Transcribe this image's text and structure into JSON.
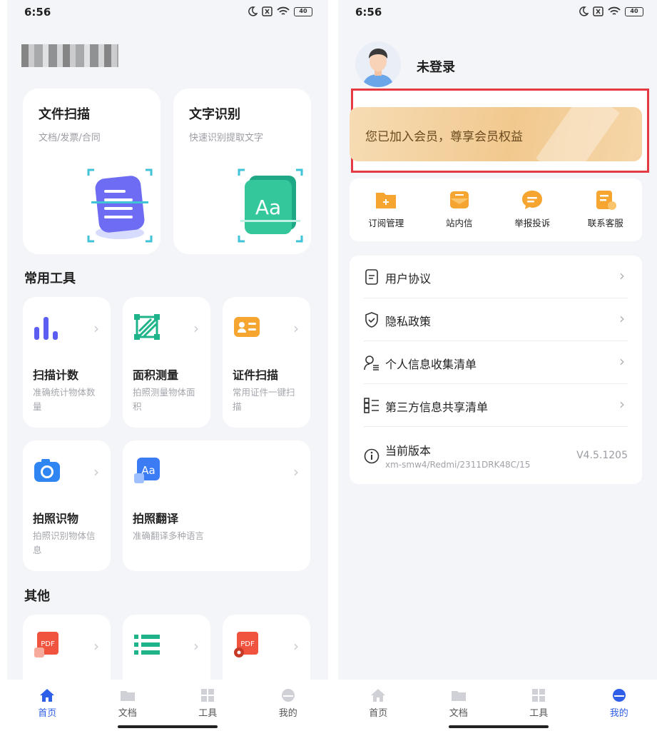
{
  "status": {
    "time": "6:56",
    "battery": "40"
  },
  "left": {
    "cards": [
      {
        "title": "文件扫描",
        "subtitle": "文档/发票/合同"
      },
      {
        "title": "文字识别",
        "subtitle": "快速识别提取文字",
        "icon_text": "Aa"
      }
    ],
    "section_common": "常用工具",
    "tools": [
      {
        "title": "扫描计数",
        "desc": "准确统计物体数量",
        "icon": "bar-chart-icon"
      },
      {
        "title": "面积测量",
        "desc": "拍照测量物体面积",
        "icon": "area-measure-icon"
      },
      {
        "title": "证件扫描",
        "desc": "常用证件一键扫描",
        "icon": "id-card-icon"
      },
      {
        "title": "拍照识物",
        "desc": "拍照识别物体信息",
        "icon": "camera-icon"
      },
      {
        "title": "拍照翻译",
        "desc": "准确翻译多种语言",
        "icon": "translate-icon",
        "icon_text": "Aa"
      }
    ],
    "section_other": "其他",
    "others": [
      {
        "icon": "pdf-image-icon",
        "icon_text": "PDF"
      },
      {
        "icon": "list-icon"
      },
      {
        "icon": "pdf-settings-icon",
        "icon_text": "PDF"
      }
    ]
  },
  "nav": [
    {
      "label": "首页",
      "icon": "home-icon"
    },
    {
      "label": "文档",
      "icon": "folder-icon"
    },
    {
      "label": "工具",
      "icon": "tools-icon"
    },
    {
      "label": "我的",
      "icon": "profile-icon"
    }
  ],
  "right": {
    "user_name": "未登录",
    "member_text": "您已加入会员，尊享会员权益",
    "quick": [
      {
        "label": "订阅管理",
        "icon": "subscription-icon"
      },
      {
        "label": "站内信",
        "icon": "message-icon"
      },
      {
        "label": "举报投诉",
        "icon": "report-icon"
      },
      {
        "label": "联系客服",
        "icon": "customer-service-icon"
      }
    ],
    "menu": [
      {
        "label": "用户协议",
        "icon": "document-icon"
      },
      {
        "label": "隐私政策",
        "icon": "shield-check-icon"
      },
      {
        "label": "个人信息收集清单",
        "icon": "person-list-icon"
      },
      {
        "label": "第三方信息共享清单",
        "icon": "grid-list-icon"
      }
    ],
    "version": {
      "label": "当前版本",
      "sub": "xm-smw4/Redmi/2311DRK48C/15",
      "value": "V4.5.1205",
      "icon": "info-icon"
    }
  },
  "colors": {
    "accent": "#2f5fe8",
    "highlight": "#e53a44",
    "member_gold": "#f1c98f"
  }
}
